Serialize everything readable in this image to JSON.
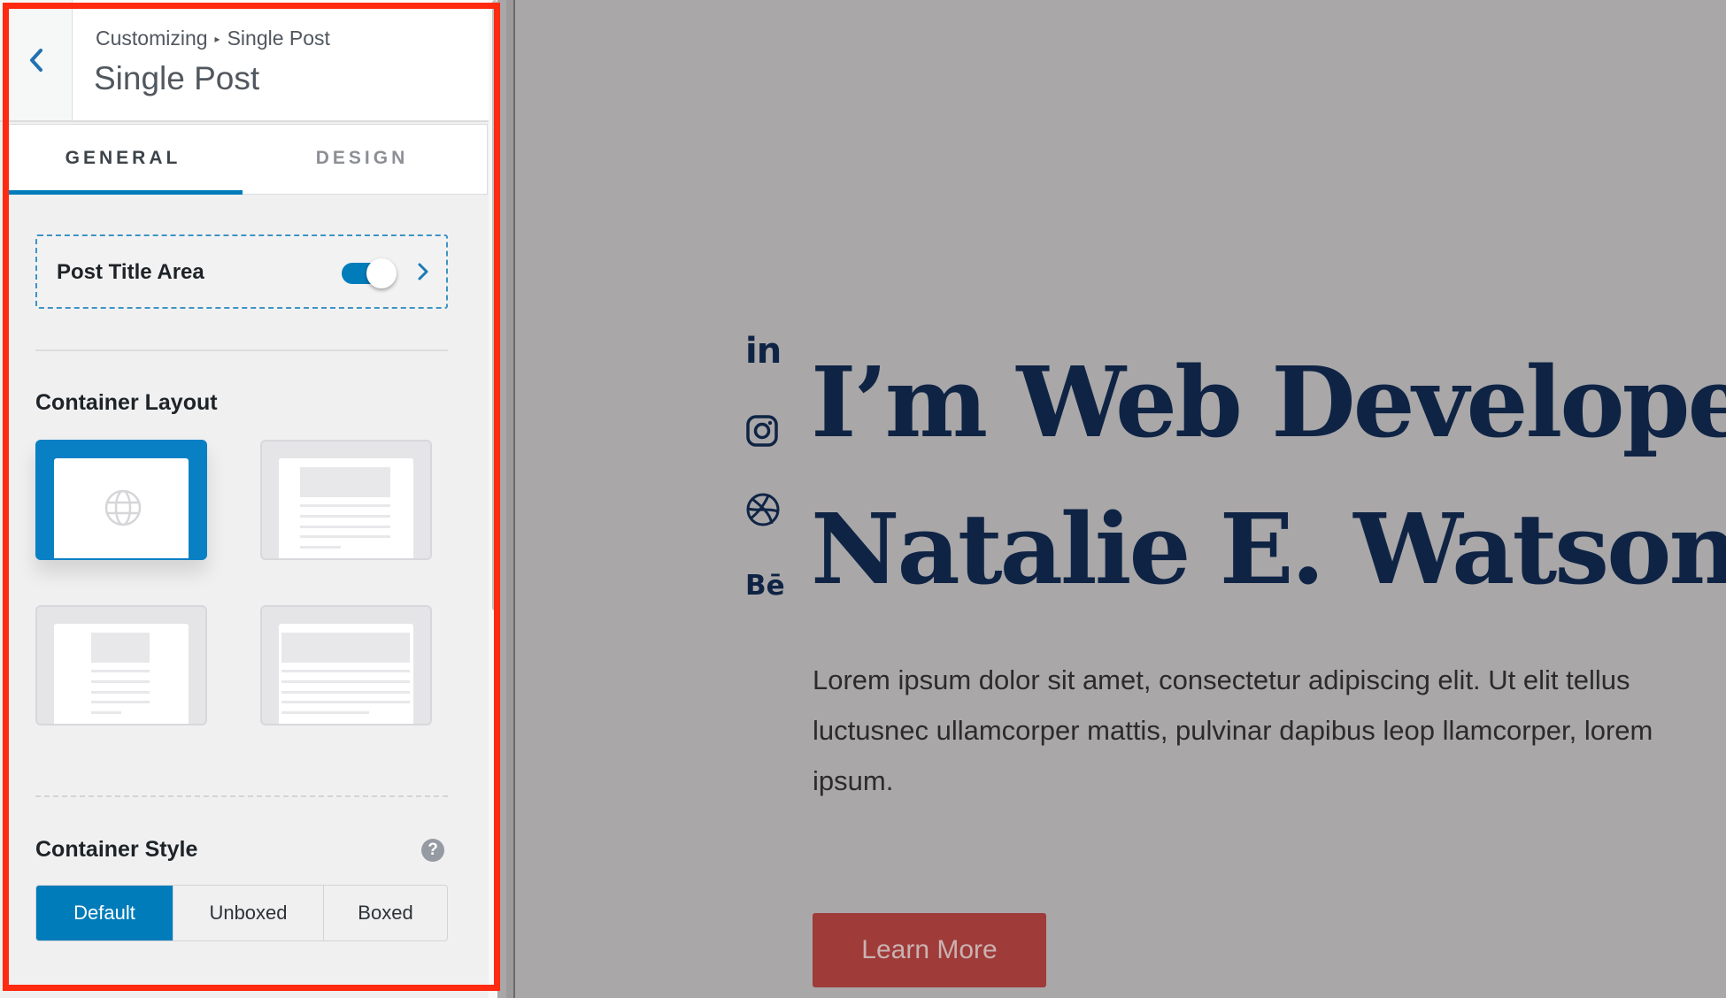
{
  "sidebar": {
    "breadcrumb": {
      "root": "Customizing",
      "separator": "▸",
      "current": "Single Post"
    },
    "title": "Single Post",
    "back_icon": "chevron-left-icon",
    "tabs": [
      {
        "label": "GENERAL",
        "active": true
      },
      {
        "label": "DESIGN",
        "active": false
      }
    ],
    "post_title_area": {
      "label": "Post Title Area",
      "enabled": true
    },
    "container_layout": {
      "label": "Container Layout",
      "options": [
        {
          "name": "default",
          "selected": true,
          "icon": "globe-icon"
        },
        {
          "name": "full-width",
          "selected": false
        },
        {
          "name": "narrow",
          "selected": false
        },
        {
          "name": "wide",
          "selected": false
        }
      ]
    },
    "container_style": {
      "label": "Container Style",
      "help_icon": "?",
      "options": [
        {
          "label": "Default",
          "active": true
        },
        {
          "label": "Unboxed",
          "active": false
        },
        {
          "label": "Boxed",
          "active": false
        }
      ]
    },
    "accent_color": "#007cba"
  },
  "preview": {
    "social_icons": [
      "linkedin-icon",
      "instagram-icon",
      "dribbble-icon",
      "behance-icon"
    ],
    "behance_text": "Bē",
    "linkedin_text": "in",
    "hero": {
      "title_line1": "I’m Web Developer",
      "title_line2": "Natalie E. Watson",
      "text": "Lorem ipsum dolor sit amet, consectetur adipiscing elit. Ut elit tellus luctusnec ullamcorper mattis, pulvinar dapibus leop llamcorper, lorem ipsum.",
      "cta_label": "Learn More"
    },
    "colors": {
      "heading": "#0f2445",
      "cta": "#9f3b39",
      "overlay": "#a9a7a8"
    }
  }
}
